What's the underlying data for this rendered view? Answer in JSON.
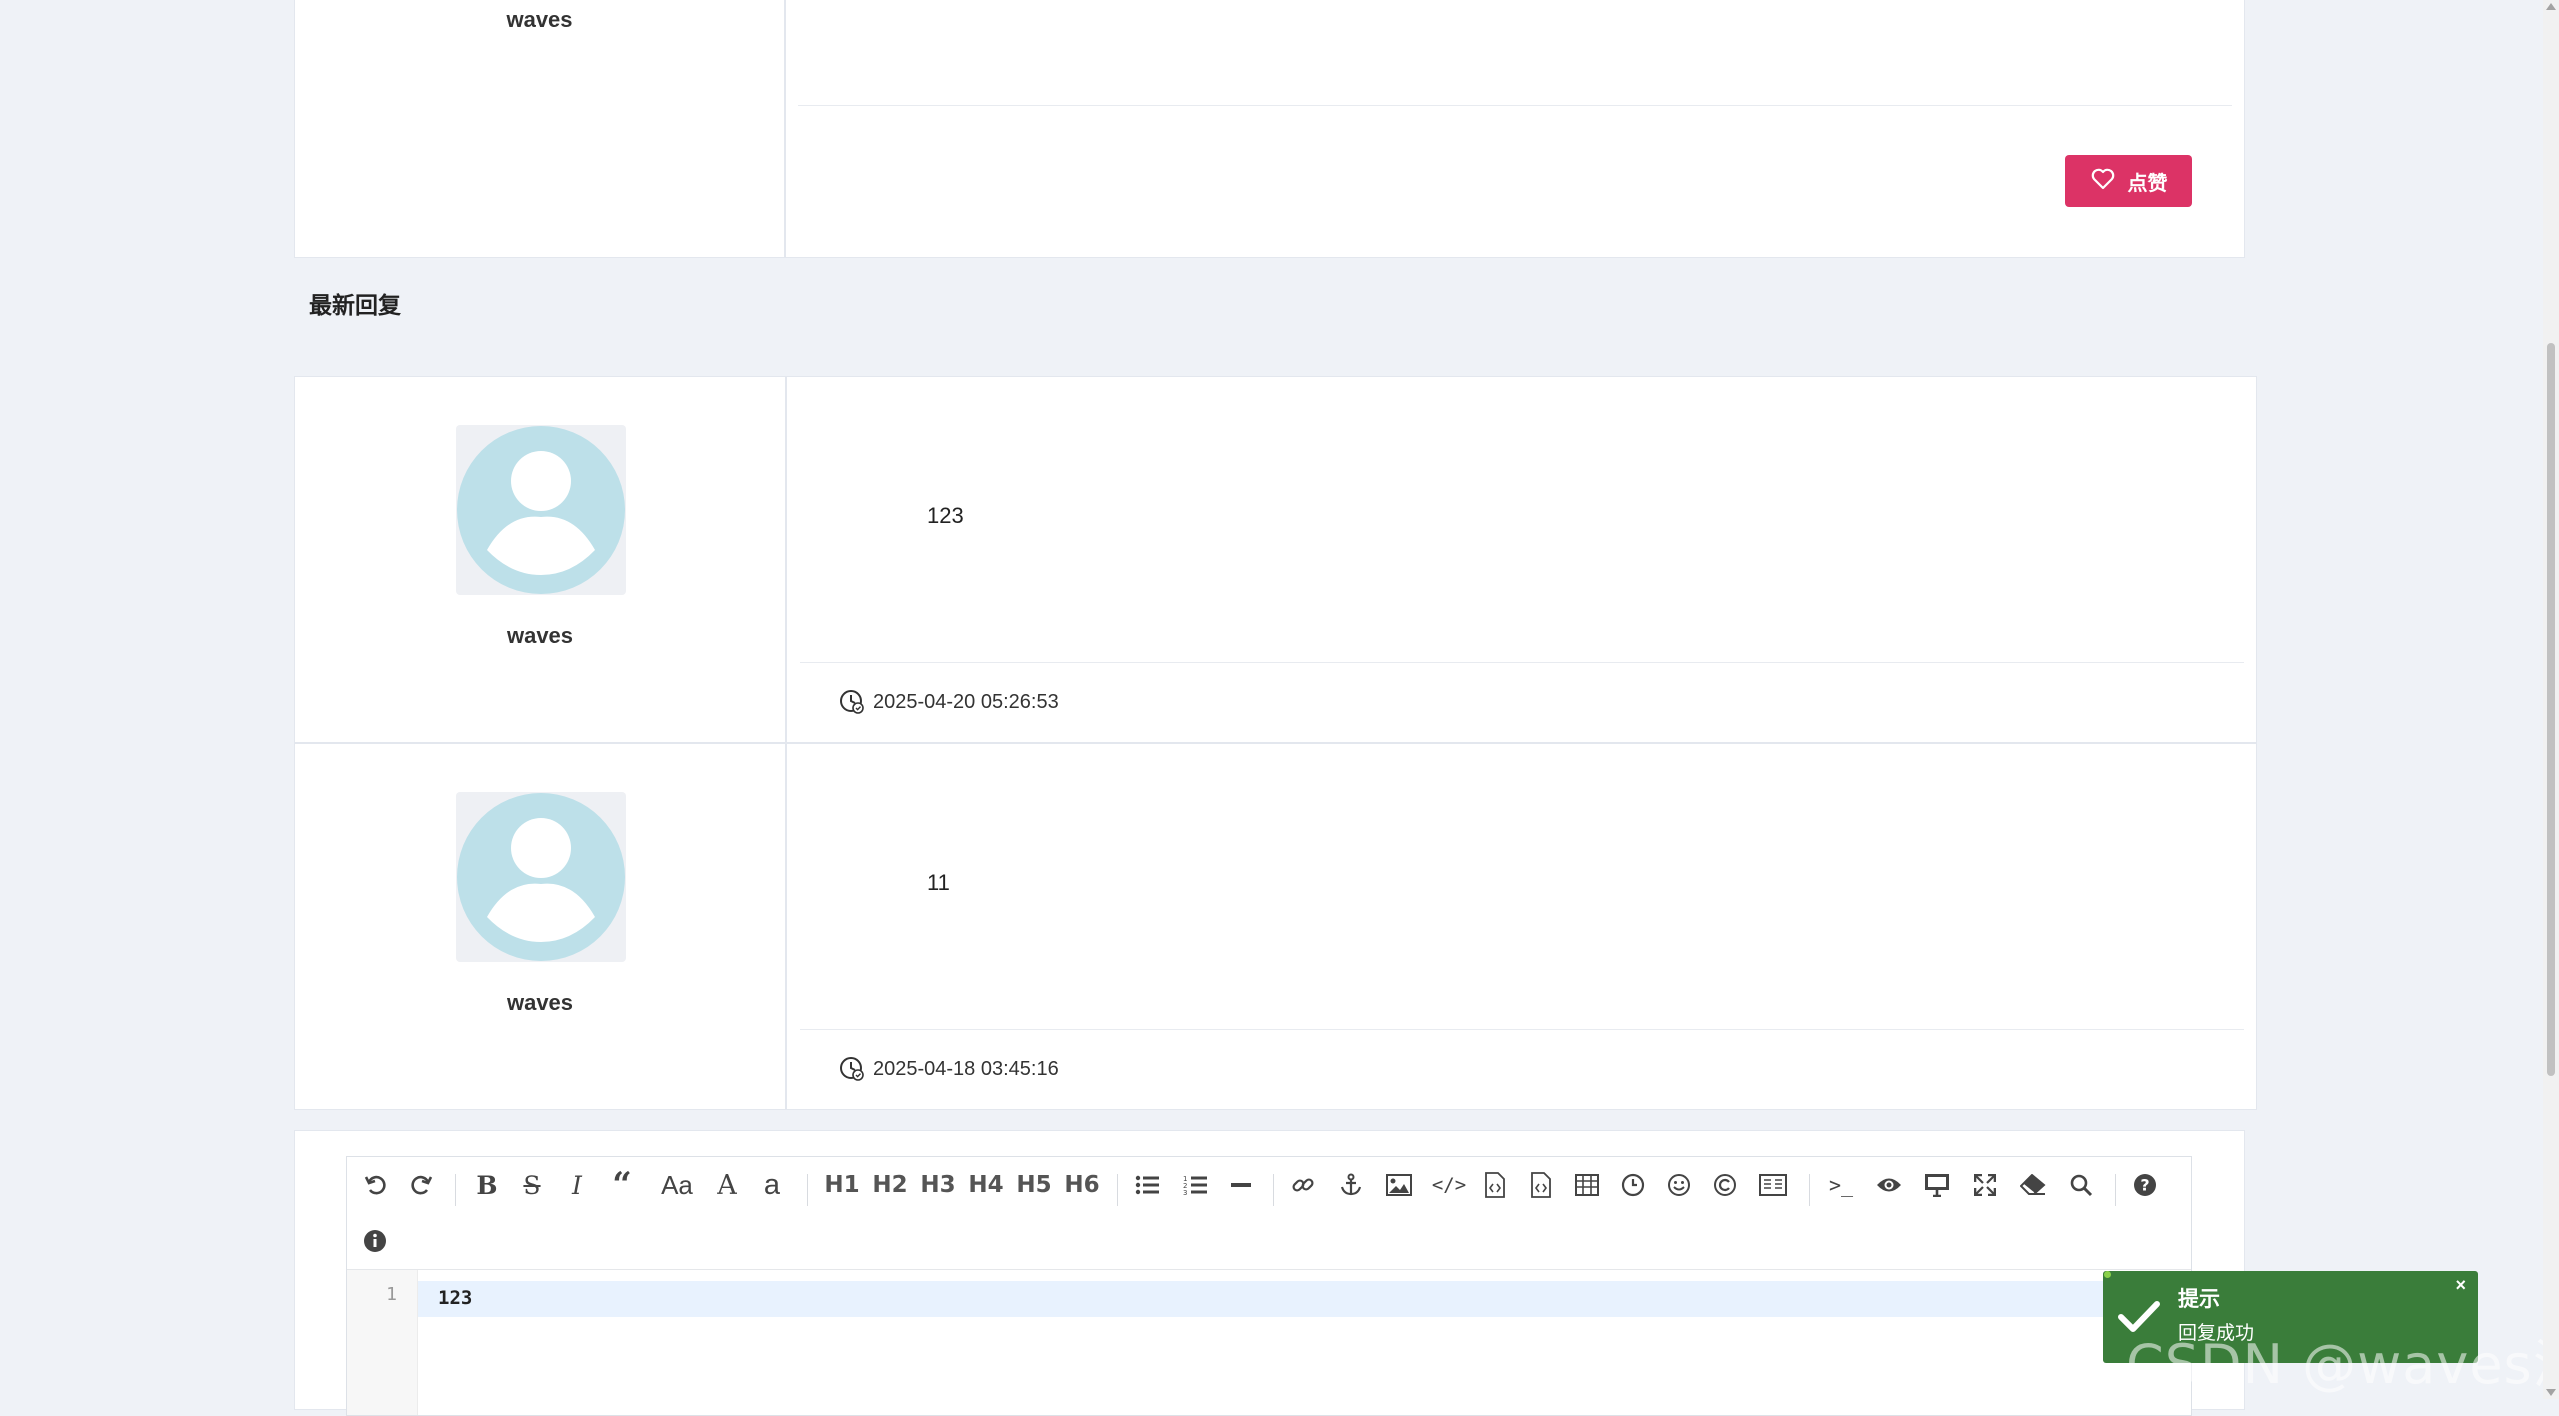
{
  "top_post": {
    "username": "waves",
    "like_label": "点赞"
  },
  "section_title": "最新回复",
  "replies": [
    {
      "username": "waves",
      "content": "123",
      "timestamp": "2025-04-20 05:26:53"
    },
    {
      "username": "waves",
      "content": "11",
      "timestamp": "2025-04-18 03:45:16"
    }
  ],
  "editor": {
    "headings": [
      "H1",
      "H2",
      "H3",
      "H4",
      "H5",
      "H6"
    ],
    "font_size_label": "Aa",
    "line_number": "1",
    "code_text": "123"
  },
  "toast": {
    "title": "提示",
    "message": "回复成功",
    "close": "×"
  },
  "watermark": "CSDN @waves浪游",
  "colors": {
    "like": "#dc3366",
    "toast": "#3a7d3a",
    "avatar": "#bde0e9",
    "page_bg": "#eff2f7"
  }
}
